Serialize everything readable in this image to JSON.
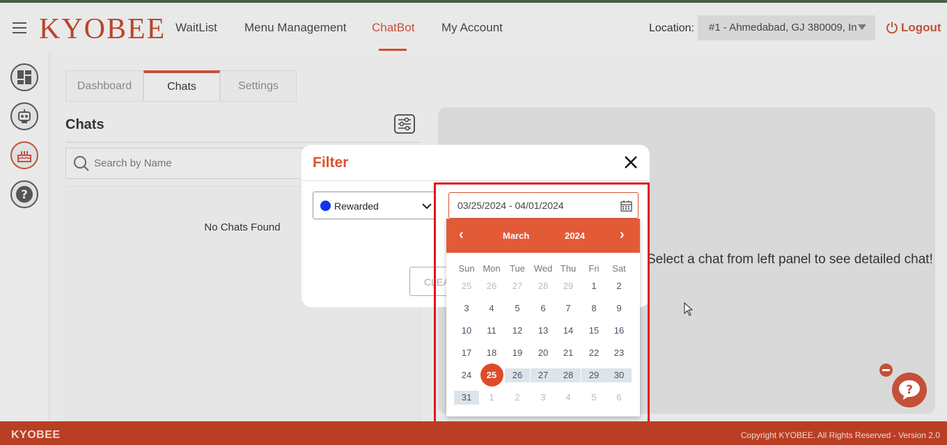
{
  "header": {
    "logo": "KYOBEE",
    "nav": [
      "WaitList",
      "Menu Management",
      "ChatBot",
      "My Account"
    ],
    "active_nav": "ChatBot",
    "location_label": "Location:",
    "location_value": "#1 - Ahmedabad, GJ 380009, In",
    "logout": "Logout",
    "accent_color": "#c4503a"
  },
  "tabs": [
    "Dashboard",
    "Chats",
    "Settings"
  ],
  "chats": {
    "title": "Chats",
    "search_placeholder": "Search by Name",
    "empty_text": "No Chats Found"
  },
  "right_panel": {
    "message": "Select a chat from left panel to see detailed chat!"
  },
  "modal": {
    "title": "Filter",
    "status_value": "Rewarded",
    "clear_label": "CLEAR",
    "date_range": "03/25/2024 - 04/01/2024"
  },
  "calendar": {
    "month": "March",
    "year": "2024",
    "prev": "‹",
    "next": "›",
    "weekdays": [
      "Sun",
      "Mon",
      "Tue",
      "Wed",
      "Thu",
      "Fri",
      "Sat"
    ],
    "days": [
      [
        "25",
        "26",
        "27",
        "28",
        "29",
        "1",
        "2"
      ],
      [
        "3",
        "4",
        "5",
        "6",
        "7",
        "8",
        "9"
      ],
      [
        "10",
        "11",
        "12",
        "13",
        "14",
        "15",
        "16"
      ],
      [
        "17",
        "18",
        "19",
        "20",
        "21",
        "22",
        "23"
      ],
      [
        "24",
        "25",
        "26",
        "27",
        "28",
        "29",
        "30"
      ],
      [
        "31",
        "1",
        "2",
        "3",
        "4",
        "5",
        "6"
      ]
    ]
  },
  "footer": {
    "logo": "KYOBEE",
    "copyright": "Copyright KYOBEE. All Rights Reserved - Version 2.0"
  }
}
